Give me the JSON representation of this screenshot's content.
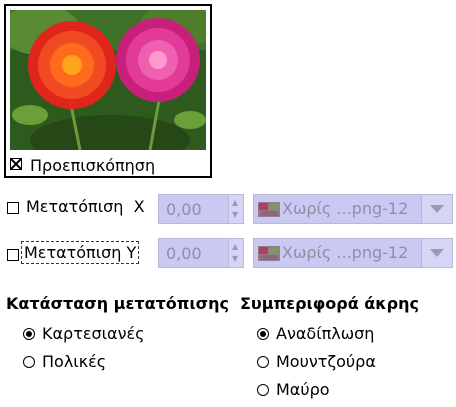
{
  "preview": {
    "checkbox_label": "Προεπισκόπηση",
    "checked": true
  },
  "offset_x": {
    "checkbox_label": "Μετατόπιση",
    "axis": "X",
    "checked": false,
    "value": "0,00",
    "map_combo": "Χωρίς ...png-12"
  },
  "offset_y": {
    "checkbox_label": "Μετατόπιση Y",
    "checked": false,
    "value": "0,00",
    "map_combo": "Χωρίς ...png-12"
  },
  "displacement_mode": {
    "heading": "Κατάσταση μετατόπισης",
    "options": [
      {
        "label": "Καρτεσιανές",
        "selected": true
      },
      {
        "label": "Πολικές",
        "selected": false
      }
    ]
  },
  "edge_behavior": {
    "heading": "Συμπεριφορά άκρης",
    "options": [
      {
        "label": "Αναδίπλωση",
        "selected": true
      },
      {
        "label": "Μουντζούρα",
        "selected": false
      },
      {
        "label": "Μαύρο",
        "selected": false
      }
    ]
  },
  "colors": {
    "disabled_fill": "#c9c9f2",
    "disabled_text": "#8e8ea8"
  }
}
